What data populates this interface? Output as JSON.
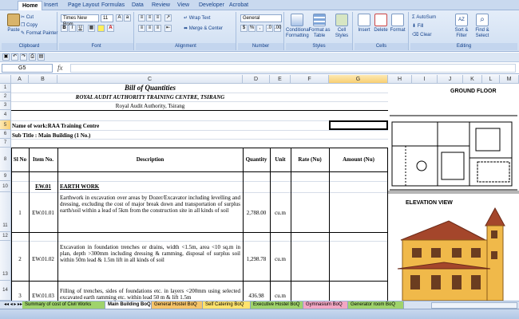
{
  "ribbon": {
    "tabs": [
      "Home",
      "Insert",
      "Page Layout",
      "Formulas",
      "Data",
      "Review",
      "View",
      "Developer",
      "Acrobat"
    ],
    "clipboard": {
      "paste": "Paste",
      "cut": "Cut",
      "copy": "Copy",
      "format_painter": "Format Painter",
      "label": "Clipboard"
    },
    "font": {
      "name": "Times New Rom",
      "size": "11",
      "label": "Font"
    },
    "alignment": {
      "wrap": "Wrap Text",
      "merge": "Merge & Center",
      "label": "Alignment"
    },
    "number": {
      "format": "General",
      "label": "Number"
    },
    "styles": {
      "conditional": "Conditional Formatting",
      "table": "Format as Table",
      "cell": "Cell Styles",
      "label": "Styles"
    },
    "cells": {
      "insert": "Insert",
      "delete": "Delete",
      "format": "Format",
      "label": "Cells"
    },
    "editing": {
      "autosum": "AutoSum",
      "fill": "Fill",
      "clear": "Clear",
      "sort": "Sort & Filter",
      "find": "Find & Select",
      "label": "Editing"
    }
  },
  "formula_bar": {
    "name_box": "G5",
    "fx": "fx"
  },
  "columns": [
    "A",
    "B",
    "C",
    "D",
    "E",
    "F",
    "G",
    "H",
    "I",
    "J",
    "K",
    "L",
    "M"
  ],
  "rows": [
    "1",
    "2",
    "3",
    "4",
    "5",
    "6",
    "7",
    "8",
    "9",
    "10",
    "11",
    "12",
    "13",
    "14"
  ],
  "sheet": {
    "title": "Bill of Quantities",
    "org": "ROYAL AUDIT AUTHORITY TRAINING CENTRE, TSIRANG",
    "client": "Royal Audit Authority, Tsirang",
    "work_name": "Name of work:RAA Training Centre",
    "subtitle": "Sub Title : Main Building (1 No.)",
    "headers": {
      "sl": "Sl No",
      "item": "Item No.",
      "desc": "Description",
      "qty": "Quantity",
      "unit": "Unit",
      "rate": "Rate (Nu)",
      "amount": "Amount (Nu)"
    },
    "section": {
      "code": "EW.01",
      "name": "EARTH WORK"
    },
    "items": [
      {
        "sl": "1",
        "code": "EW.01.01",
        "desc": "Earthwork in excavation over areas by Dozer/Excavator including levelling and dressing, excluding the cost of major break down and transportation of surplus earth/soil within a lead of 5km from the construction site in all kinds of soil",
        "qty": "2,788.00",
        "unit": "cu.m"
      },
      {
        "sl": "2",
        "code": "EW.01.02",
        "desc": "Excavation in foundation trenches or drains, width <1.5m, area <10 sq.m in plan, depth >300mm including dressing & ramming, disposal of surplus soil within 50m lead & 1.5m lift in all kinds of soil",
        "qty": "1,298.78",
        "unit": "cu.m"
      },
      {
        "sl": "3",
        "code": "EW.01.03",
        "desc": "Filling of trenches, sides of foundations etc. in layers <200mm using selected excavated earth ramming etc. within lead 50 m & lift 1.5m",
        "qty": "436.98",
        "unit": "cu.m"
      }
    ]
  },
  "panel": {
    "ground_floor": "GROUND FLOOR",
    "elevation": "ELEVATION VIEW"
  },
  "sheet_tabs": [
    "Summary of cost of Civil Works",
    "Main Building BoQ",
    "General Hostel BoQ",
    "Self Catering BoQ",
    "Executive Hostel BoQ",
    "Gymnasium BoQ",
    "Generator room BoQ"
  ],
  "colors": {
    "tab_orange": "#f6c46a",
    "tab_yellow": "#ffe36e",
    "tab_green": "#9fd36c",
    "tab_pink": "#f2a7c4",
    "house_wall": "#f0b94a",
    "house_roof": "#a4462b"
  }
}
